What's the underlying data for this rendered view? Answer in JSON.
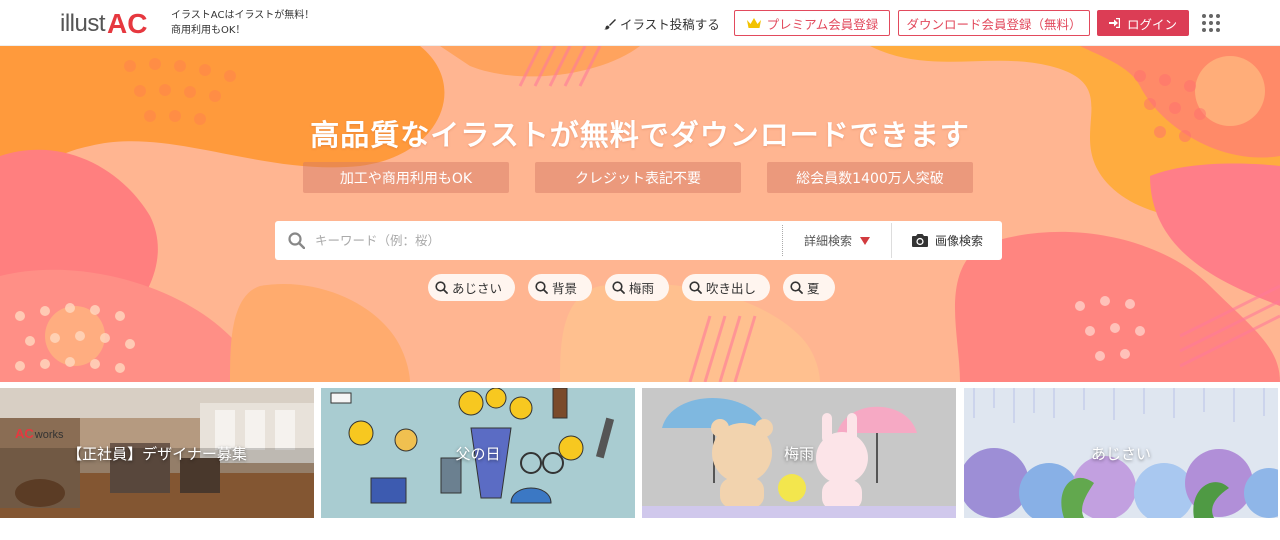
{
  "header": {
    "logo_illust": "illust",
    "logo_ac": "AC",
    "tagline_line1": "イラストACはイラストが無料！",
    "tagline_line2": "商用利用もOK！",
    "post_label": "イラスト投稿する",
    "premium_label": "プレミアム会員登録",
    "register_label": "ダウンロード会員登録（無料）",
    "login_label": "ログイン"
  },
  "hero": {
    "title": "高品質なイラストが無料でダウンロードできます",
    "features": [
      "加工や商用利用もOK",
      "クレジット表記不要",
      "総会員数1400万人突破"
    ],
    "search": {
      "placeholder": "キーワード（例：桜）",
      "value": "",
      "detail_label": "詳細検索",
      "image_search_label": "画像検索"
    },
    "tags": [
      "あじさい",
      "背景",
      "梅雨",
      "吹き出し",
      "夏"
    ]
  },
  "tiles": [
    {
      "label": "【正社員】デザイナー募集",
      "badge_ac": "AC",
      "badge_works": "works"
    },
    {
      "label": "父の日"
    },
    {
      "label": "梅雨"
    },
    {
      "label": "あじさい"
    }
  ],
  "colors": {
    "brand_red": "#e6383f",
    "login_bg": "#dc3d55",
    "hero_peach": "#ffb08a",
    "hero_orange": "#ff9a3c",
    "hero_pink": "#ff8a80"
  },
  "icons": {
    "post": "brush-icon",
    "premium": "crown-icon",
    "login": "sign-in-icon",
    "menu": "grid-dots-icon",
    "search": "search-icon",
    "detail": "triangle-down-icon",
    "image_search": "camera-icon"
  }
}
